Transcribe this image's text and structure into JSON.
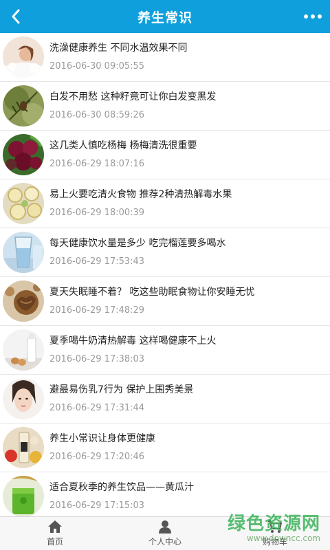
{
  "header": {
    "title": "养生常识"
  },
  "articles": [
    {
      "title": "洗澡健康养生 不同水温效果不同",
      "date": "2016-06-30 09:05:55",
      "thumb": "woman-bath"
    },
    {
      "title": "白发不用愁 这种籽竟可让你白发变黑发",
      "date": "2016-06-30 08:59:26",
      "thumb": "pine-branch"
    },
    {
      "title": "这几类人慎吃杨梅 杨梅清洗很重要",
      "date": "2016-06-29 18:07:16",
      "thumb": "bayberries"
    },
    {
      "title": "易上火要吃清火食物 推荐2种清热解毒水果",
      "date": "2016-06-29 18:00:39",
      "thumb": "fruit-slices"
    },
    {
      "title": "每天健康饮水量是多少 吃完榴莲要多喝水",
      "date": "2016-06-29 17:53:43",
      "thumb": "water-glass"
    },
    {
      "title": "夏天失眠睡不着？ 吃这些助眠食物让你安睡无忧",
      "date": "2016-06-29 17:48:29",
      "thumb": "walnuts"
    },
    {
      "title": "夏季喝牛奶清热解毒 这样喝健康不上火",
      "date": "2016-06-29 17:38:03",
      "thumb": "milk-eggs"
    },
    {
      "title": "避最易伤乳7行为 保护上围秀美景",
      "date": "2016-06-29 17:31:44",
      "thumb": "woman-face"
    },
    {
      "title": "养生小常识让身体更健康",
      "date": "2016-06-29 17:20:46",
      "thumb": "drinks"
    },
    {
      "title": "适合夏秋季的养生饮品——黄瓜汁",
      "date": "2016-06-29 17:15:03",
      "thumb": "green-juice"
    }
  ],
  "tabbar": {
    "home": "首页",
    "profile": "个人中心",
    "cart": "购物车"
  },
  "watermark": {
    "cn": "绿色资源网",
    "en": "www.downcc.com"
  },
  "colors": {
    "header": "#0f9fdc",
    "title_text": "#222222",
    "date_text": "#9a9a9a",
    "watermark": "#3cb45a"
  }
}
